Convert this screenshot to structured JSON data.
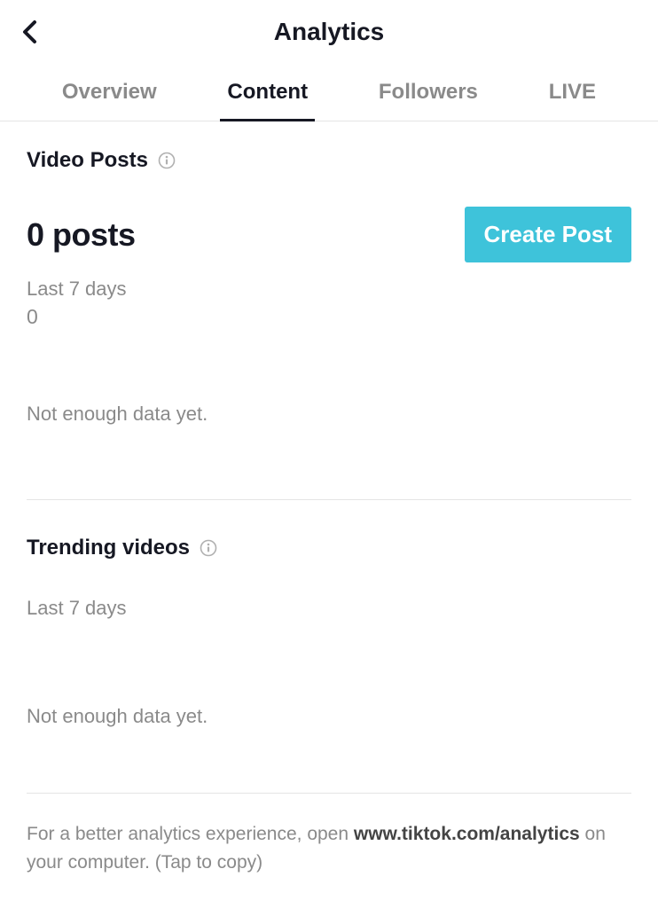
{
  "header": {
    "title": "Analytics"
  },
  "tabs": {
    "items": [
      {
        "label": "Overview"
      },
      {
        "label": "Content"
      },
      {
        "label": "Followers"
      },
      {
        "label": "LIVE"
      }
    ],
    "activeIndex": 1
  },
  "videoPosts": {
    "title": "Video Posts",
    "countLabel": "0 posts",
    "createButton": "Create Post",
    "rangeLabel": "Last 7 days",
    "rangeCount": "0",
    "noData": "Not enough data yet."
  },
  "trending": {
    "title": "Trending videos",
    "rangeLabel": "Last 7 days",
    "noData": "Not enough data yet."
  },
  "footer": {
    "prefix": "For a better analytics experience, open ",
    "bold": "www.tiktok.com/analytics",
    "suffix": " on your computer. (Tap to copy)"
  }
}
